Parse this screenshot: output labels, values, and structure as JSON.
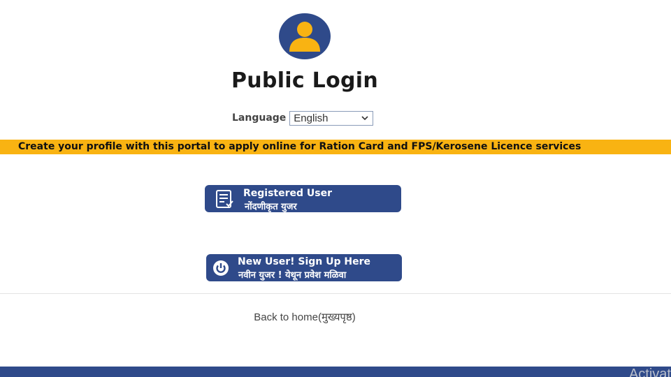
{
  "header": {
    "avatar_icon": "user-avatar-icon",
    "title": "Public Login"
  },
  "language": {
    "label": "Language",
    "selected": "English",
    "chevron_icon": "chevron-down-icon"
  },
  "banner": {
    "text": "Create your profile with this portal to apply online for Ration Card and FPS/Kerosene Licence services",
    "color": "#f9b312"
  },
  "buttons": {
    "registered": {
      "label_en": "Registered User",
      "label_mr": "नोंदणीकृत युजर",
      "icon": "document-check-icon"
    },
    "new_user": {
      "label_en": "New User! Sign Up Here",
      "label_mr": "नवीन युजर ! येथून प्रवेश मळिवा",
      "icon": "power-icon"
    }
  },
  "back_link": {
    "text": "Back to home(मुख्यपृष्ठ)"
  },
  "theme": {
    "primary": "#2f4a8a",
    "accent": "#f9b312"
  },
  "overlay": {
    "watermark": "Activat"
  }
}
